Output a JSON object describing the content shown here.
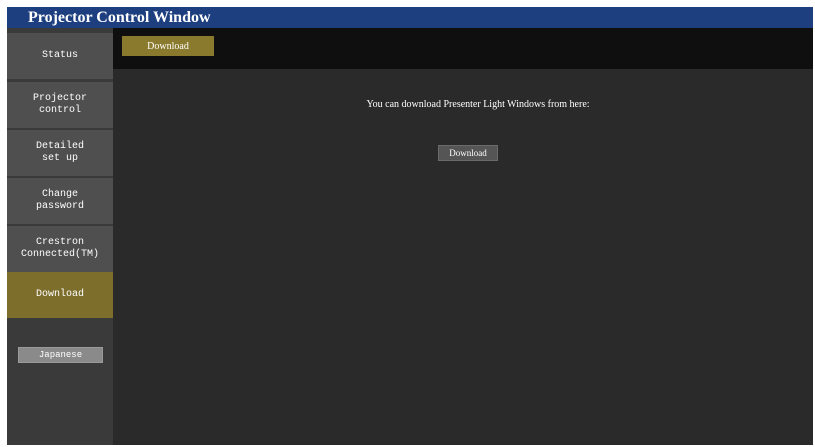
{
  "window": {
    "title": "Projector Control Window"
  },
  "sidebar": {
    "items": [
      {
        "label": "Status",
        "active": false
      },
      {
        "label": "Projector\ncontrol",
        "active": false
      },
      {
        "label": "Detailed\nset up",
        "active": false
      },
      {
        "label": "Change\npassword",
        "active": false
      },
      {
        "label": "Crestron\nConnected(TM)",
        "active": false
      },
      {
        "label": "Download",
        "active": true
      }
    ],
    "language_button": "Japanese"
  },
  "tabs": [
    {
      "label": "Download",
      "active": true
    }
  ],
  "main": {
    "message": "You can download Presenter Light Windows from here:",
    "download_button": "Download"
  },
  "colors": {
    "title_bar": "#1e3f7f",
    "active_accent": "#7d6e2c",
    "sidebar_item": "#4f4f4f",
    "content_bg": "#2a2a2a"
  }
}
